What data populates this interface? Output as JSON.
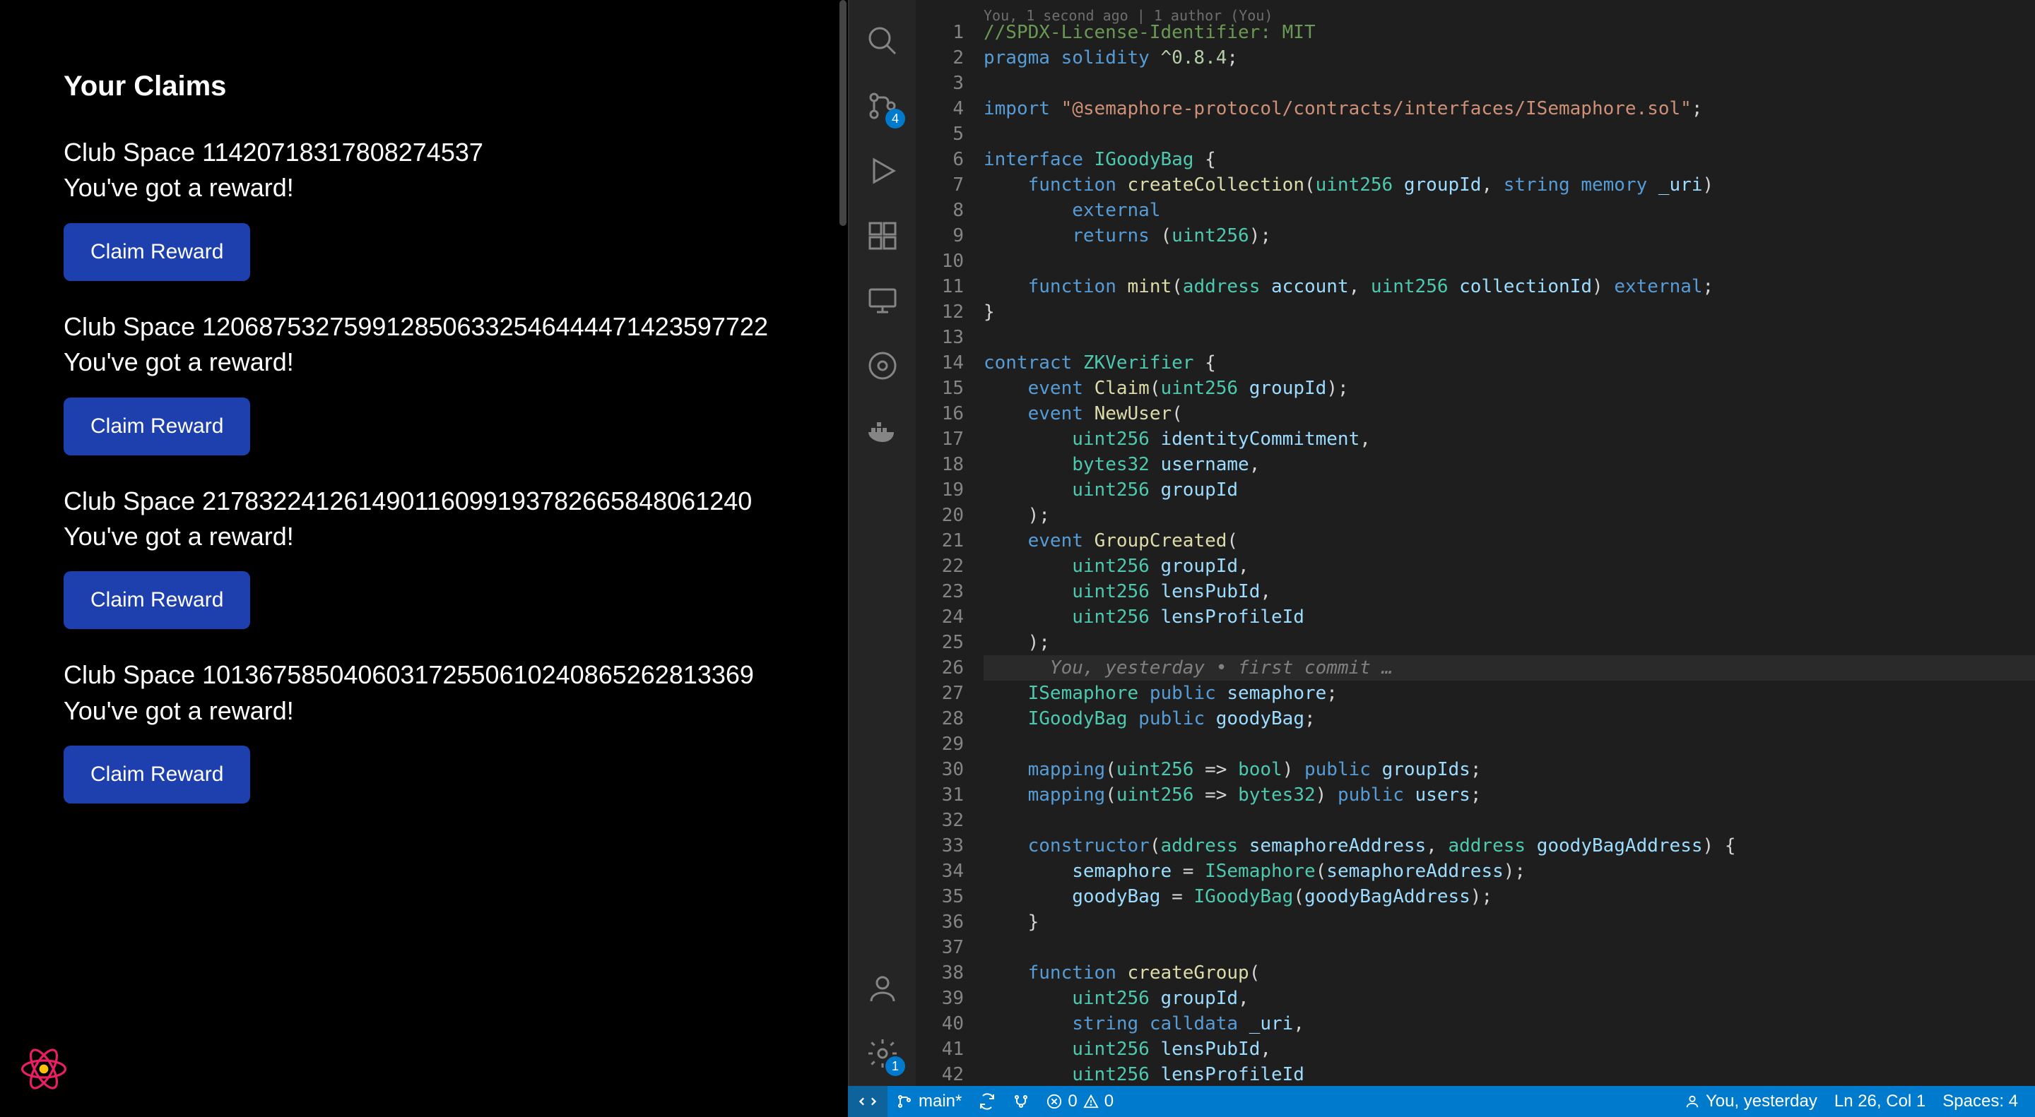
{
  "leftPanel": {
    "title": "Your Claims",
    "claimButton": "Claim Reward",
    "rewardText": "You've got a reward!",
    "claims": [
      {
        "name": "Club Space 11420718317808274537"
      },
      {
        "name": "Club Space 1206875327599128506332546444471423597722"
      },
      {
        "name": "Club Space 217832241261490116099193782665848061240"
      },
      {
        "name": "Club Space 101367585040603172550610240865262813369"
      }
    ]
  },
  "activityBar": {
    "scmBadge": "4",
    "settingsBadge": "1"
  },
  "editor": {
    "codelens": "You, 1 second ago | 1 author (You)",
    "inlineAnnotation": "You, yesterday • first commit …",
    "currentLine": 26,
    "lines": [
      {
        "n": 1,
        "tokens": [
          [
            "comment",
            "//SPDX-License-Identifier: MIT"
          ]
        ]
      },
      {
        "n": 2,
        "tokens": [
          [
            "kw",
            "pragma"
          ],
          [
            "punct",
            " "
          ],
          [
            "kw",
            "solidity"
          ],
          [
            "punct",
            " "
          ],
          [
            "num",
            "^0.8.4"
          ],
          [
            "punct",
            ";"
          ]
        ]
      },
      {
        "n": 3,
        "tokens": []
      },
      {
        "n": 4,
        "tokens": [
          [
            "kw",
            "import"
          ],
          [
            "punct",
            " "
          ],
          [
            "str",
            "\"@semaphore-protocol/contracts/interfaces/ISemaphore.sol\""
          ],
          [
            "punct",
            ";"
          ]
        ]
      },
      {
        "n": 5,
        "tokens": []
      },
      {
        "n": 6,
        "tokens": [
          [
            "kw",
            "interface"
          ],
          [
            "punct",
            " "
          ],
          [
            "type",
            "IGoodyBag"
          ],
          [
            "punct",
            " {"
          ]
        ]
      },
      {
        "n": 7,
        "tokens": [
          [
            "punct",
            "    "
          ],
          [
            "kw",
            "function"
          ],
          [
            "punct",
            " "
          ],
          [
            "fn",
            "createCollection"
          ],
          [
            "punct",
            "("
          ],
          [
            "type",
            "uint256"
          ],
          [
            "punct",
            " "
          ],
          [
            "param",
            "groupId"
          ],
          [
            "punct",
            ", "
          ],
          [
            "kw",
            "string"
          ],
          [
            "punct",
            " "
          ],
          [
            "kw",
            "memory"
          ],
          [
            "punct",
            " "
          ],
          [
            "param",
            "_uri"
          ],
          [
            "punct",
            ")"
          ]
        ]
      },
      {
        "n": 8,
        "tokens": [
          [
            "punct",
            "        "
          ],
          [
            "kw",
            "external"
          ]
        ]
      },
      {
        "n": 9,
        "tokens": [
          [
            "punct",
            "        "
          ],
          [
            "kw",
            "returns"
          ],
          [
            "punct",
            " ("
          ],
          [
            "type",
            "uint256"
          ],
          [
            "punct",
            ");"
          ]
        ]
      },
      {
        "n": 10,
        "tokens": []
      },
      {
        "n": 11,
        "tokens": [
          [
            "punct",
            "    "
          ],
          [
            "kw",
            "function"
          ],
          [
            "punct",
            " "
          ],
          [
            "fn",
            "mint"
          ],
          [
            "punct",
            "("
          ],
          [
            "type",
            "address"
          ],
          [
            "punct",
            " "
          ],
          [
            "param",
            "account"
          ],
          [
            "punct",
            ", "
          ],
          [
            "type",
            "uint256"
          ],
          [
            "punct",
            " "
          ],
          [
            "param",
            "collectionId"
          ],
          [
            "punct",
            ") "
          ],
          [
            "kw",
            "external"
          ],
          [
            "punct",
            ";"
          ]
        ]
      },
      {
        "n": 12,
        "tokens": [
          [
            "punct",
            "}"
          ]
        ]
      },
      {
        "n": 13,
        "tokens": []
      },
      {
        "n": 14,
        "tokens": [
          [
            "kw",
            "contract"
          ],
          [
            "punct",
            " "
          ],
          [
            "type",
            "ZKVerifier"
          ],
          [
            "punct",
            " {"
          ]
        ]
      },
      {
        "n": 15,
        "tokens": [
          [
            "punct",
            "    "
          ],
          [
            "kw",
            "event"
          ],
          [
            "punct",
            " "
          ],
          [
            "fn",
            "Claim"
          ],
          [
            "punct",
            "("
          ],
          [
            "type",
            "uint256"
          ],
          [
            "punct",
            " "
          ],
          [
            "param",
            "groupId"
          ],
          [
            "punct",
            ");"
          ]
        ]
      },
      {
        "n": 16,
        "tokens": [
          [
            "punct",
            "    "
          ],
          [
            "kw",
            "event"
          ],
          [
            "punct",
            " "
          ],
          [
            "fn",
            "NewUser"
          ],
          [
            "punct",
            "("
          ]
        ]
      },
      {
        "n": 17,
        "tokens": [
          [
            "punct",
            "        "
          ],
          [
            "type",
            "uint256"
          ],
          [
            "punct",
            " "
          ],
          [
            "param",
            "identityCommitment"
          ],
          [
            "punct",
            ","
          ]
        ]
      },
      {
        "n": 18,
        "tokens": [
          [
            "punct",
            "        "
          ],
          [
            "type",
            "bytes32"
          ],
          [
            "punct",
            " "
          ],
          [
            "param",
            "username"
          ],
          [
            "punct",
            ","
          ]
        ]
      },
      {
        "n": 19,
        "tokens": [
          [
            "punct",
            "        "
          ],
          [
            "type",
            "uint256"
          ],
          [
            "punct",
            " "
          ],
          [
            "param",
            "groupId"
          ]
        ]
      },
      {
        "n": 20,
        "tokens": [
          [
            "punct",
            "    );"
          ]
        ]
      },
      {
        "n": 21,
        "tokens": [
          [
            "punct",
            "    "
          ],
          [
            "kw",
            "event"
          ],
          [
            "punct",
            " "
          ],
          [
            "fn",
            "GroupCreated"
          ],
          [
            "punct",
            "("
          ]
        ]
      },
      {
        "n": 22,
        "tokens": [
          [
            "punct",
            "        "
          ],
          [
            "type",
            "uint256"
          ],
          [
            "punct",
            " "
          ],
          [
            "param",
            "groupId"
          ],
          [
            "punct",
            ","
          ]
        ]
      },
      {
        "n": 23,
        "tokens": [
          [
            "punct",
            "        "
          ],
          [
            "type",
            "uint256"
          ],
          [
            "punct",
            " "
          ],
          [
            "param",
            "lensPubId"
          ],
          [
            "punct",
            ","
          ]
        ]
      },
      {
        "n": 24,
        "tokens": [
          [
            "punct",
            "        "
          ],
          [
            "type",
            "uint256"
          ],
          [
            "punct",
            " "
          ],
          [
            "param",
            "lensProfileId"
          ]
        ]
      },
      {
        "n": 25,
        "tokens": [
          [
            "punct",
            "    );"
          ]
        ]
      },
      {
        "n": 26,
        "tokens": [],
        "annot": true
      },
      {
        "n": 27,
        "tokens": [
          [
            "punct",
            "    "
          ],
          [
            "type",
            "ISemaphore"
          ],
          [
            "punct",
            " "
          ],
          [
            "kw",
            "public"
          ],
          [
            "punct",
            " "
          ],
          [
            "param",
            "semaphore"
          ],
          [
            "punct",
            ";"
          ]
        ]
      },
      {
        "n": 28,
        "tokens": [
          [
            "punct",
            "    "
          ],
          [
            "type",
            "IGoodyBag"
          ],
          [
            "punct",
            " "
          ],
          [
            "kw",
            "public"
          ],
          [
            "punct",
            " "
          ],
          [
            "param",
            "goodyBag"
          ],
          [
            "punct",
            ";"
          ]
        ]
      },
      {
        "n": 29,
        "tokens": []
      },
      {
        "n": 30,
        "tokens": [
          [
            "punct",
            "    "
          ],
          [
            "kw",
            "mapping"
          ],
          [
            "punct",
            "("
          ],
          [
            "type",
            "uint256"
          ],
          [
            "punct",
            " => "
          ],
          [
            "type",
            "bool"
          ],
          [
            "punct",
            ") "
          ],
          [
            "kw",
            "public"
          ],
          [
            "punct",
            " "
          ],
          [
            "param",
            "groupIds"
          ],
          [
            "punct",
            ";"
          ]
        ]
      },
      {
        "n": 31,
        "tokens": [
          [
            "punct",
            "    "
          ],
          [
            "kw",
            "mapping"
          ],
          [
            "punct",
            "("
          ],
          [
            "type",
            "uint256"
          ],
          [
            "punct",
            " => "
          ],
          [
            "type",
            "bytes32"
          ],
          [
            "punct",
            ") "
          ],
          [
            "kw",
            "public"
          ],
          [
            "punct",
            " "
          ],
          [
            "param",
            "users"
          ],
          [
            "punct",
            ";"
          ]
        ]
      },
      {
        "n": 32,
        "tokens": []
      },
      {
        "n": 33,
        "tokens": [
          [
            "punct",
            "    "
          ],
          [
            "kw",
            "constructor"
          ],
          [
            "punct",
            "("
          ],
          [
            "type",
            "address"
          ],
          [
            "punct",
            " "
          ],
          [
            "param",
            "semaphoreAddress"
          ],
          [
            "punct",
            ", "
          ],
          [
            "type",
            "address"
          ],
          [
            "punct",
            " "
          ],
          [
            "param",
            "goodyBagAddress"
          ],
          [
            "punct",
            ") {"
          ]
        ]
      },
      {
        "n": 34,
        "tokens": [
          [
            "punct",
            "        "
          ],
          [
            "param",
            "semaphore"
          ],
          [
            "punct",
            " = "
          ],
          [
            "type",
            "ISemaphore"
          ],
          [
            "punct",
            "("
          ],
          [
            "param",
            "semaphoreAddress"
          ],
          [
            "punct",
            ");"
          ]
        ]
      },
      {
        "n": 35,
        "tokens": [
          [
            "punct",
            "        "
          ],
          [
            "param",
            "goodyBag"
          ],
          [
            "punct",
            " = "
          ],
          [
            "type",
            "IGoodyBag"
          ],
          [
            "punct",
            "("
          ],
          [
            "param",
            "goodyBagAddress"
          ],
          [
            "punct",
            ");"
          ]
        ]
      },
      {
        "n": 36,
        "tokens": [
          [
            "punct",
            "    }"
          ]
        ]
      },
      {
        "n": 37,
        "tokens": []
      },
      {
        "n": 38,
        "tokens": [
          [
            "punct",
            "    "
          ],
          [
            "kw",
            "function"
          ],
          [
            "punct",
            " "
          ],
          [
            "fn",
            "createGroup"
          ],
          [
            "punct",
            "("
          ]
        ]
      },
      {
        "n": 39,
        "tokens": [
          [
            "punct",
            "        "
          ],
          [
            "type",
            "uint256"
          ],
          [
            "punct",
            " "
          ],
          [
            "param",
            "groupId"
          ],
          [
            "punct",
            ","
          ]
        ]
      },
      {
        "n": 40,
        "tokens": [
          [
            "punct",
            "        "
          ],
          [
            "kw",
            "string"
          ],
          [
            "punct",
            " "
          ],
          [
            "kw",
            "calldata"
          ],
          [
            "punct",
            " "
          ],
          [
            "param",
            "_uri"
          ],
          [
            "punct",
            ","
          ]
        ]
      },
      {
        "n": 41,
        "tokens": [
          [
            "punct",
            "        "
          ],
          [
            "type",
            "uint256"
          ],
          [
            "punct",
            " "
          ],
          [
            "param",
            "lensPubId"
          ],
          [
            "punct",
            ","
          ]
        ]
      },
      {
        "n": 42,
        "tokens": [
          [
            "punct",
            "        "
          ],
          [
            "type",
            "uint256"
          ],
          [
            "punct",
            " "
          ],
          [
            "param",
            "lensProfileId"
          ]
        ]
      }
    ]
  },
  "statusBar": {
    "branch": "main*",
    "errors": "0",
    "warnings": "0",
    "blame": "You, yesterday",
    "position": "Ln 26, Col 1",
    "spaces": "Spaces: 4"
  }
}
